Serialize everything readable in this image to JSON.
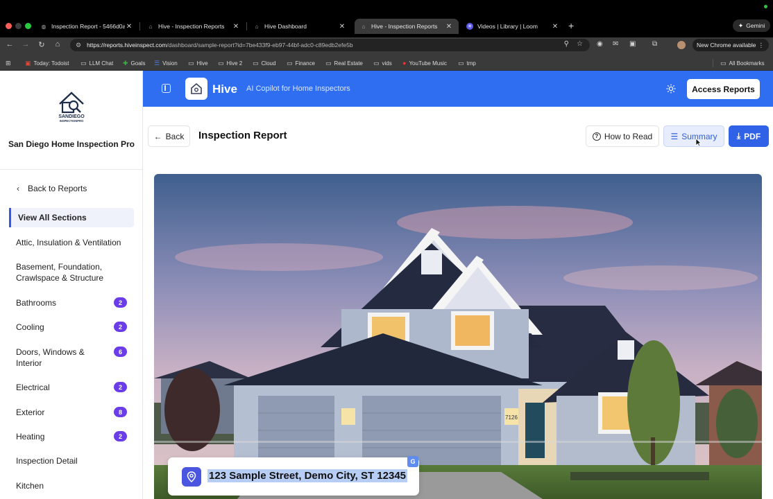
{
  "browser": {
    "tabs": [
      {
        "title": "Inspection Report - 5466d0a",
        "active": false
      },
      {
        "title": "Hive - Inspection Reports",
        "active": false
      },
      {
        "title": "Hive Dashboard",
        "active": false
      },
      {
        "title": "Hive - Inspection Reports",
        "active": true
      },
      {
        "title": "Videos | Library | Loom",
        "active": false
      }
    ],
    "gemini_label": "Gemini",
    "url_host": "https://reports.hiveinspect.com",
    "url_path": "/dashboard/sample-report?id=7be433f9-eb97-44bf-adc0-c89edb2efe5b",
    "new_chrome_label": "New Chrome available",
    "bookmarks": [
      "Today: Todoist",
      "LLM Chat",
      "Goals",
      "Vision",
      "Hive",
      "Hive 2",
      "Cloud",
      "Finance",
      "Real Estate",
      "vids",
      "YouTube Music",
      "tmp"
    ],
    "all_bookmarks_label": "All Bookmarks"
  },
  "sidebar": {
    "logo_line1": "SANDIEGO",
    "logo_line2": "INSPECTIONPRO",
    "company_name": "San Diego Home Inspection Pro",
    "back_label": "Back to Reports",
    "items": [
      {
        "label": "View All Sections",
        "badge": ""
      },
      {
        "label": "Attic, Insulation & Ventilation",
        "badge": ""
      },
      {
        "label": "Basement, Foundation, Crawlspace & Structure",
        "badge": ""
      },
      {
        "label": "Bathrooms",
        "badge": "2"
      },
      {
        "label": "Cooling",
        "badge": "2"
      },
      {
        "label": "Doors, Windows & Interior",
        "badge": "6"
      },
      {
        "label": "Electrical",
        "badge": "2"
      },
      {
        "label": "Exterior",
        "badge": "8"
      },
      {
        "label": "Heating",
        "badge": "2"
      },
      {
        "label": "Inspection Detail",
        "badge": ""
      },
      {
        "label": "Kitchen",
        "badge": ""
      }
    ]
  },
  "header": {
    "app_name": "Hive",
    "tagline": "AI Copilot for Home Inspectors",
    "access_reports_label": "Access Reports"
  },
  "page": {
    "back_label": "Back",
    "title": "Inspection Report",
    "how_to_read_label": "How to Read",
    "summary_label": "Summary",
    "pdf_label": "PDF",
    "house_number": "7126",
    "address": "123 Sample Street, Demo City, ST 12345"
  },
  "colors": {
    "brand_blue": "#2f6ef0",
    "badge_purple": "#6a3de8",
    "pin_indigo": "#4a56e0"
  }
}
